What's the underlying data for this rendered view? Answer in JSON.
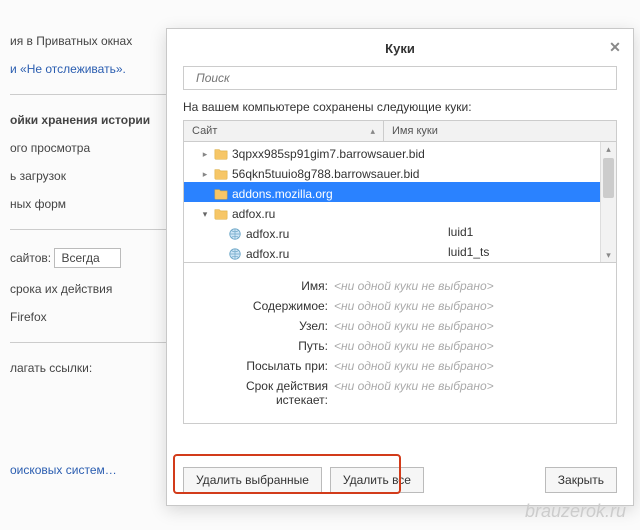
{
  "bg": {
    "line1": "ия в Приватных окнах",
    "link1": "и «Не отслеживать».",
    "sec2": "ойки хранения истории",
    "l2a": "ого просмотра",
    "l2b": "ь загрузок",
    "l2c": "ных форм",
    "sites_label": "сайтов:",
    "sites_value": "Всегда",
    "expire": "срока их действия",
    "fx": "Firefox",
    "suggest": "лагать ссылки:",
    "engines": "оисковых систем…"
  },
  "modal": {
    "title": "Куки",
    "search_placeholder": "Поиск",
    "description": "На вашем компьютере сохранены следующие куки:",
    "columns": {
      "site": "Сайт",
      "name": "Имя куки"
    },
    "rows": [
      {
        "type": "folder",
        "expand": "closed",
        "label": "3qpxx985sp91gim7.barrowsauer.bid",
        "col2": "",
        "depth": 1,
        "selected": false
      },
      {
        "type": "folder",
        "expand": "closed",
        "label": "56qkn5tuuio8g788.barrowsauer.bid",
        "col2": "",
        "depth": 1,
        "selected": false
      },
      {
        "type": "folder",
        "expand": "none",
        "label": "addons.mozilla.org",
        "col2": "",
        "depth": 1,
        "selected": true
      },
      {
        "type": "folder",
        "expand": "open",
        "label": "adfox.ru",
        "col2": "",
        "depth": 1,
        "selected": false
      },
      {
        "type": "cookie",
        "expand": "none",
        "label": "adfox.ru",
        "col2": "luid1",
        "depth": 2,
        "selected": false
      },
      {
        "type": "cookie",
        "expand": "none",
        "label": "adfox.ru",
        "col2": "luid1_ts",
        "depth": 2,
        "selected": false
      }
    ],
    "details": {
      "labels": {
        "name": "Имя:",
        "content": "Содержимое:",
        "host": "Узел:",
        "path": "Путь:",
        "send": "Посылать при:",
        "expires": "Срок действия истекает:"
      },
      "placeholder": "<ни одной куки не выбрано>"
    },
    "buttons": {
      "remove_selected": "Удалить выбранные",
      "remove_all": "Удалить все",
      "close": "Закрыть"
    }
  },
  "watermark": "brauzerok.ru"
}
